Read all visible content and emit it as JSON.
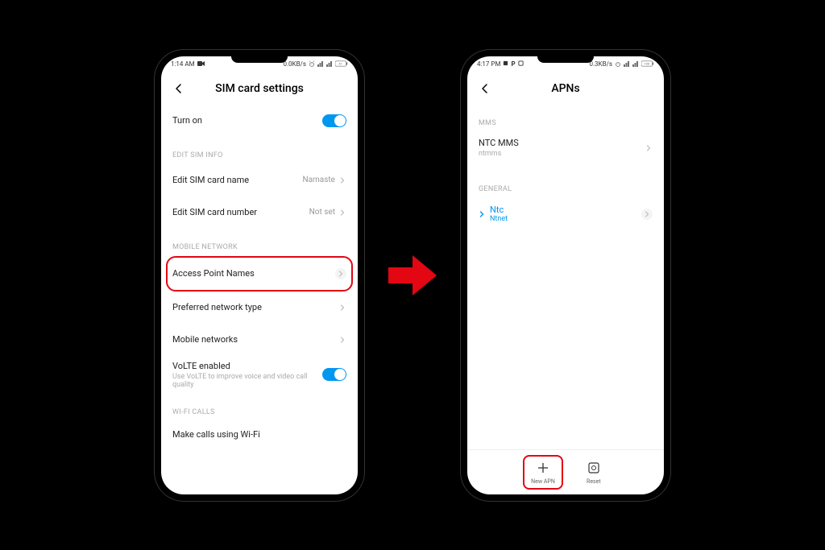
{
  "phone1": {
    "statusbar": {
      "time": "1:14 AM",
      "speed": "0.0KB/s",
      "battery": "61"
    },
    "title": "SIM card settings",
    "turn_on": "Turn on",
    "sections": {
      "edit_sim": "EDIT SIM INFO",
      "mobile_network": "MOBILE NETWORK",
      "wifi_calls": "WI-FI CALLS"
    },
    "rows": {
      "edit_name": "Edit SIM card name",
      "edit_name_val": "Namaste",
      "edit_number": "Edit SIM card number",
      "edit_number_val": "Not set",
      "apn": "Access Point Names",
      "pref_network": "Preferred network type",
      "mobile_networks": "Mobile networks",
      "volte": "VoLTE enabled",
      "volte_sub": "Use VoLTE to improve voice and video call quality",
      "wifi_call": "Make calls using Wi-Fi"
    }
  },
  "phone2": {
    "statusbar": {
      "time": "4:17 PM",
      "speed": "0.3KB/s",
      "battery": "100"
    },
    "title": "APNs",
    "sections": {
      "mms": "MMS",
      "general": "GENERAL"
    },
    "rows": {
      "mms_name": "NTC MMS",
      "mms_sub": "ntmms",
      "ntc": "Ntc",
      "ntc_sub": "Ntnet"
    },
    "bottom": {
      "new_apn": "New APN",
      "reset": "Reset"
    }
  }
}
